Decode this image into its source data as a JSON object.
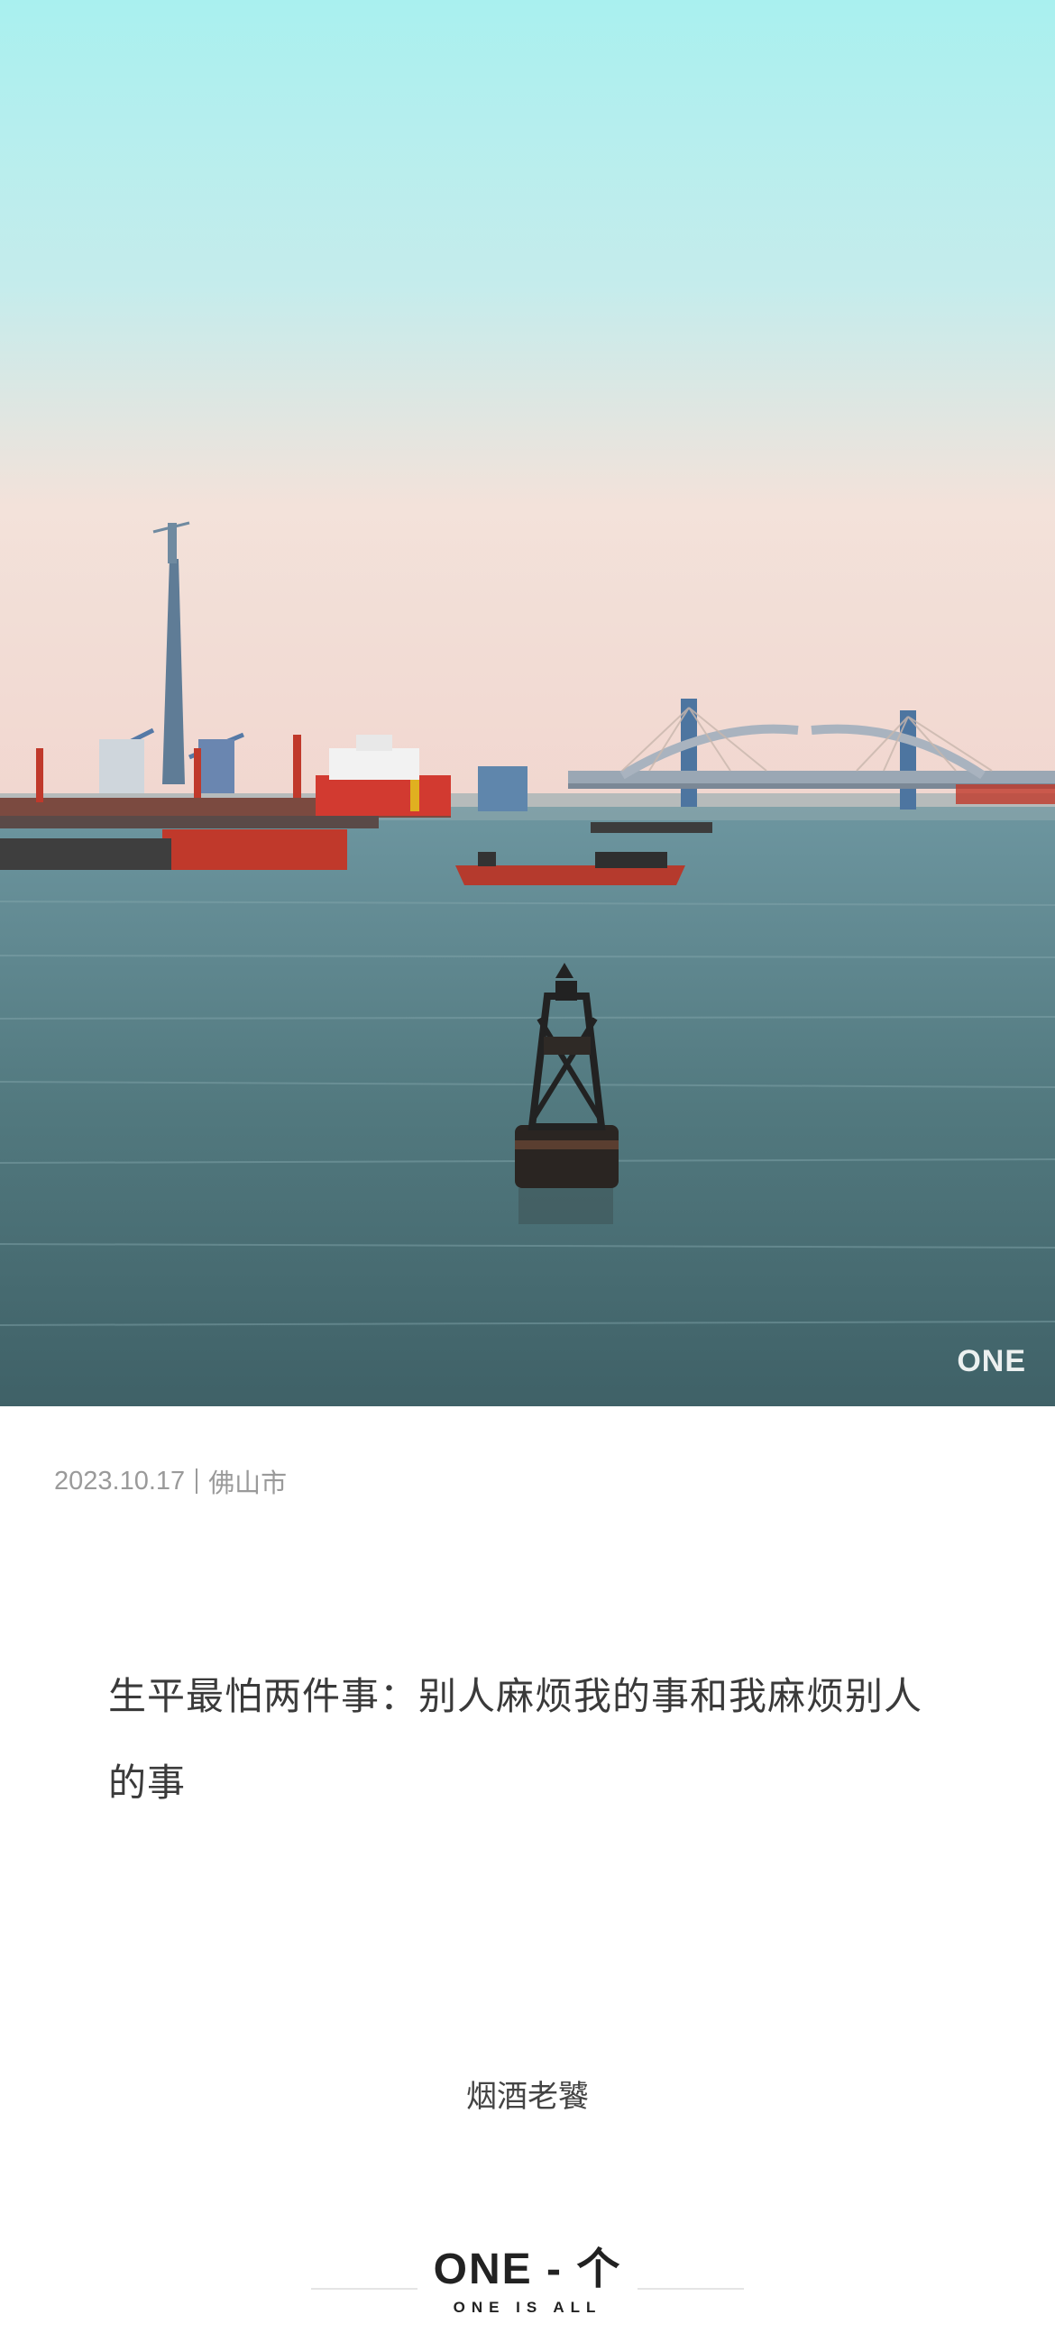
{
  "photo": {
    "watermark": "ONE"
  },
  "meta": {
    "date": "2023.10.17",
    "location": "佛山市"
  },
  "quote": {
    "text": "生平最怕两件事：别人麻烦我的事和我麻烦别人的事"
  },
  "author": {
    "name": "烟酒老饕"
  },
  "footer": {
    "logo": "ONE - 个",
    "tagline": "ONE IS ALL"
  },
  "colors": {
    "sky_top": "#aef0f0",
    "sky_bottom": "#f6dcd2",
    "water": "#4f7a82",
    "text_gray": "#9a9a9a"
  }
}
